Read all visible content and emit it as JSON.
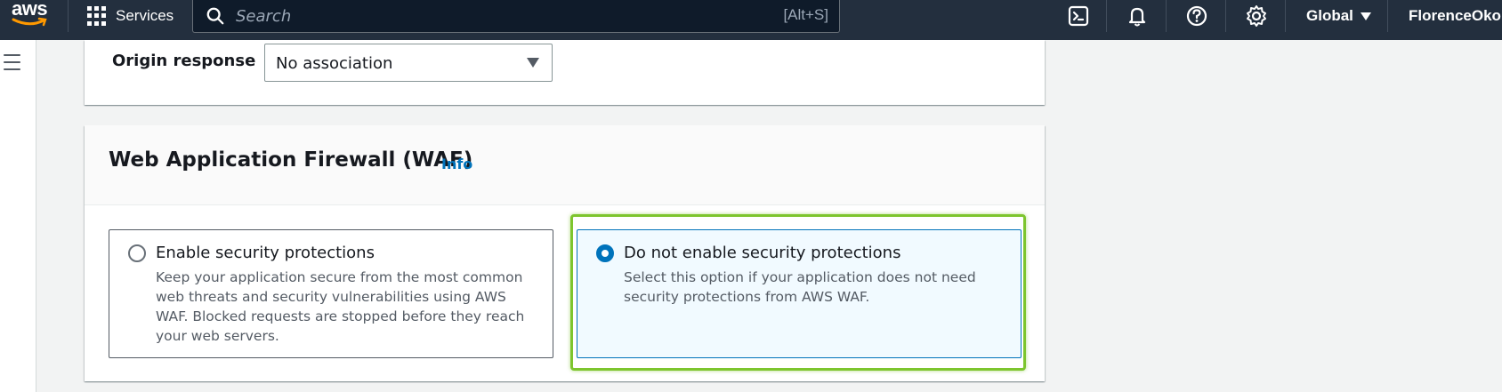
{
  "topnav": {
    "logo_text": "aws",
    "services_label": "Services",
    "search": {
      "placeholder": "Search",
      "shortcut": "[Alt+S]"
    },
    "icons": [
      "cloudshell-icon",
      "notifications-icon",
      "help-icon",
      "settings-icon"
    ],
    "region": "Global",
    "user": "FlorenceOkoli"
  },
  "origin_response": {
    "label": "Origin response",
    "selected_value": "No association"
  },
  "waf": {
    "title": "Web Application Firewall (WAF)",
    "info_link": "Info",
    "options": [
      {
        "title": "Enable security protections",
        "description": "Keep your application secure from the most common web threats and security vulnerabilities using AWS WAF. Blocked requests are stopped before they reach your web servers.",
        "selected": false
      },
      {
        "title": "Do not enable security protections",
        "description": "Select this option if your application does not need security protections from AWS WAF.",
        "selected": true
      }
    ]
  },
  "colors": {
    "nav_bg": "#232f3e",
    "link": "#0073bb",
    "selected_tile_bg": "#f1faff",
    "highlight": "#7dc52e"
  }
}
